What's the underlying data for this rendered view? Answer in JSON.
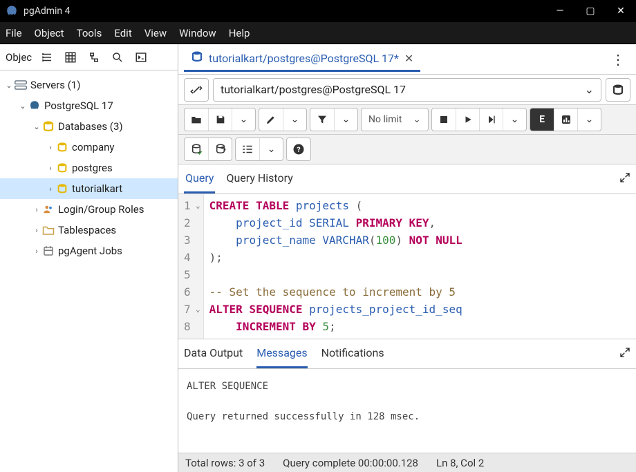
{
  "window": {
    "title": "pgAdmin 4"
  },
  "menu": {
    "items": [
      "File",
      "Object",
      "Tools",
      "Edit",
      "View",
      "Window",
      "Help"
    ]
  },
  "sidebar": {
    "label": "Objec",
    "tree": {
      "servers": {
        "label": "Servers (1)"
      },
      "pg": {
        "label": "PostgreSQL 17"
      },
      "databases": {
        "label": "Databases (3)"
      },
      "db0": {
        "label": "company"
      },
      "db1": {
        "label": "postgres"
      },
      "db2": {
        "label": "tutorialkart"
      },
      "roles": {
        "label": "Login/Group Roles"
      },
      "tablespaces": {
        "label": "Tablespaces"
      },
      "jobs": {
        "label": "pgAgent Jobs"
      }
    }
  },
  "tab": {
    "title": "tutorialkart/postgres@PostgreSQL 17*"
  },
  "connection": {
    "text": "tutorialkart/postgres@PostgreSQL 17"
  },
  "toolbar": {
    "nolimit": "No limit"
  },
  "query_tabs": {
    "query": "Query",
    "history": "Query History"
  },
  "editor": {
    "lines": [
      {
        "n": "1",
        "fold": true
      },
      {
        "n": "2"
      },
      {
        "n": "3"
      },
      {
        "n": "4"
      },
      {
        "n": "5"
      },
      {
        "n": "6"
      },
      {
        "n": "7",
        "fold": true
      },
      {
        "n": "8"
      }
    ],
    "tokens": {
      "l1_kw1": "CREATE",
      "l1_kw2": "TABLE",
      "l1_id": "projects",
      "l1_p1": " (",
      "l2_id": "project_id",
      "l2_fn": "SERIAL",
      "l2_kw": "PRIMARY KEY",
      "l2_c": ",",
      "l3_id": "project_name",
      "l3_fn": "VARCHAR",
      "l3_p1": "(",
      "l3_num": "100",
      "l3_p2": ")",
      "l3_kw": "NOT NULL",
      "l4": ");",
      "l6_cmt": "-- Set the sequence to increment by 5",
      "l7_kw1": "ALTER",
      "l7_kw2": "SEQUENCE",
      "l7_id": "projects_project_id_seq",
      "l8_kw1": "INCREMENT",
      "l8_kw2": "BY",
      "l8_num": "5",
      "l8_p": ";"
    }
  },
  "output_tabs": {
    "data": "Data Output",
    "messages": "Messages",
    "notif": "Notifications"
  },
  "messages": {
    "line1": "ALTER SEQUENCE",
    "line2": "Query returned successfully in 128 msec."
  },
  "status": {
    "rows": "Total rows: 3 of 3",
    "time": "Query complete 00:00:00.128",
    "pos": "Ln 8, Col 2"
  }
}
